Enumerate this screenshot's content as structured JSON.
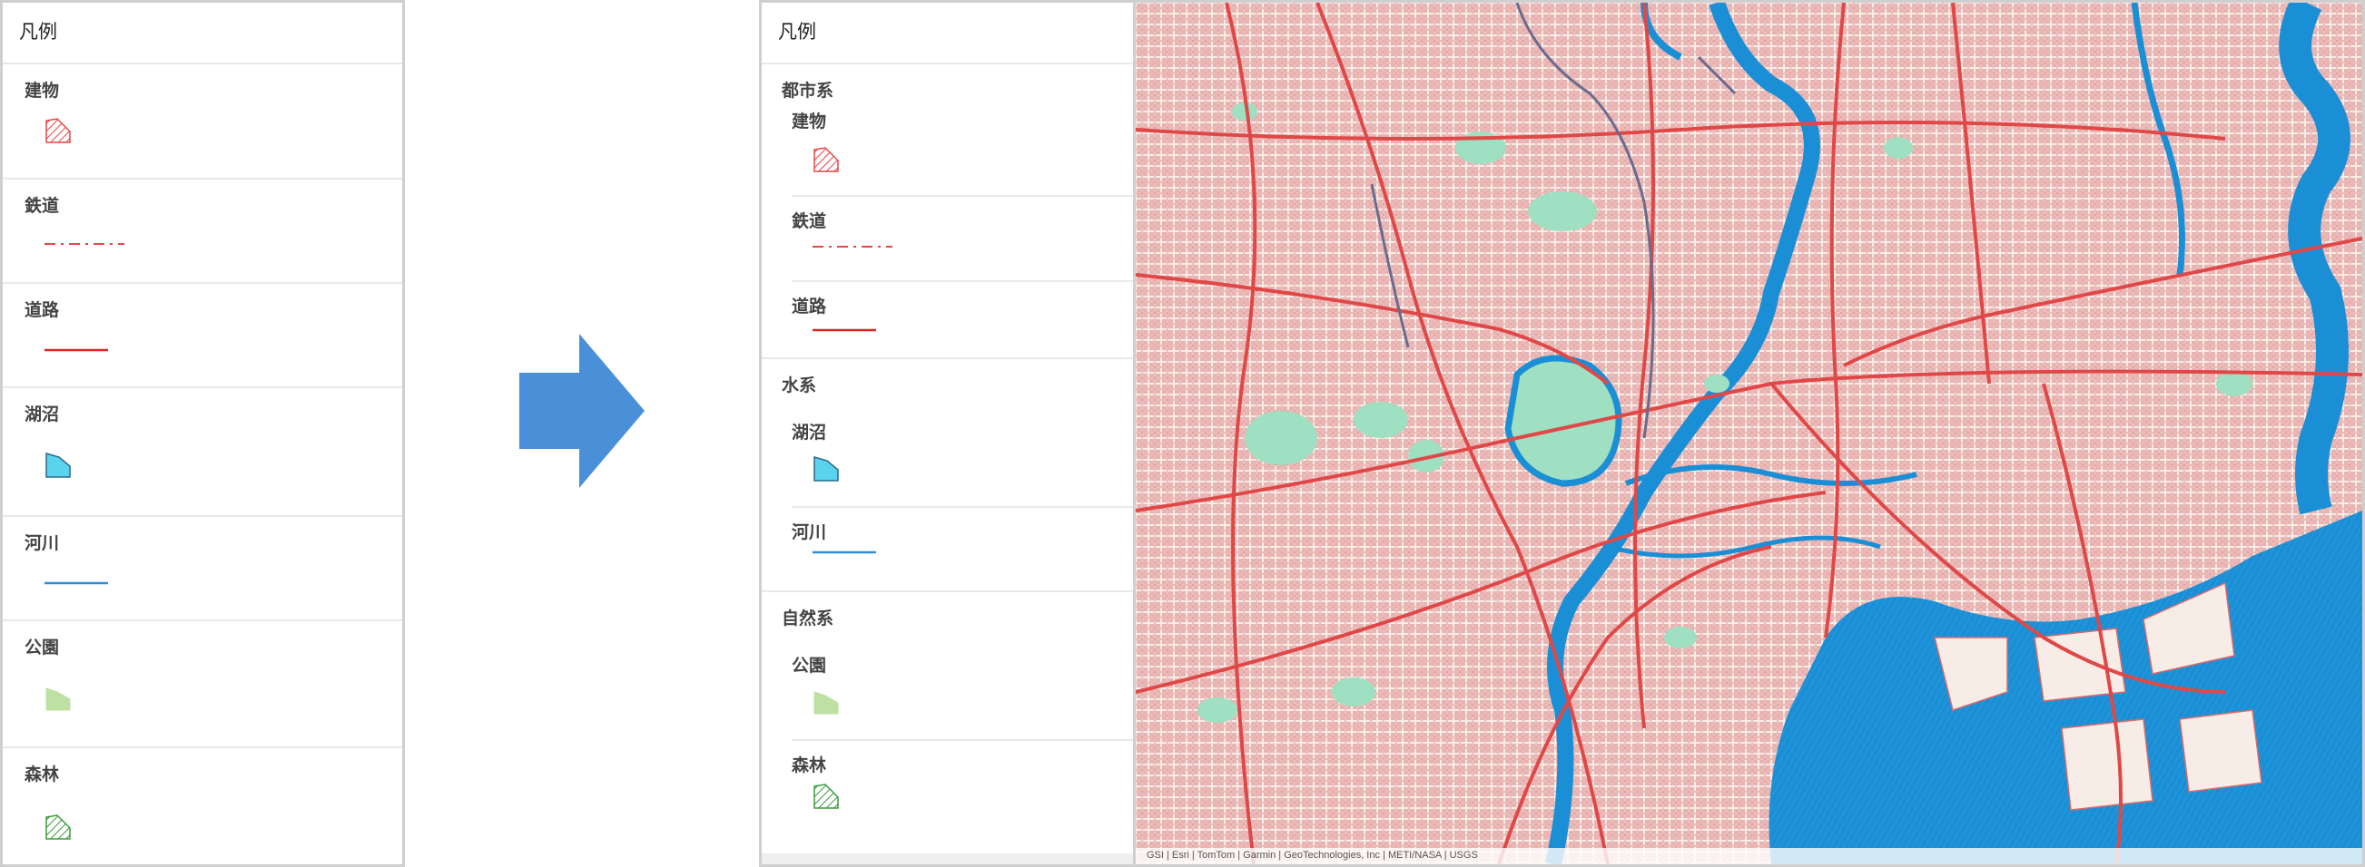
{
  "left_panel": {
    "title": "凡例",
    "items": [
      {
        "label": "建物",
        "symbol": "hatched-red-polygon"
      },
      {
        "label": "鉄道",
        "symbol": "red-dash-dot-line"
      },
      {
        "label": "道路",
        "symbol": "red-line"
      },
      {
        "label": "湖沼",
        "symbol": "cyan-polygon"
      },
      {
        "label": "河川",
        "symbol": "blue-line"
      },
      {
        "label": "公園",
        "symbol": "green-polygon"
      },
      {
        "label": "森林",
        "symbol": "hatched-green-polygon"
      }
    ]
  },
  "arrow": {
    "icon": "right-arrow-icon",
    "color": "#4a90d9"
  },
  "right_panel": {
    "title": "凡例",
    "groups": [
      {
        "label": "都市系",
        "items": [
          {
            "label": "建物",
            "symbol": "hatched-red-polygon"
          },
          {
            "label": "鉄道",
            "symbol": "red-dash-dot-line"
          },
          {
            "label": "道路",
            "symbol": "red-line"
          }
        ]
      },
      {
        "label": "水系",
        "items": [
          {
            "label": "湖沼",
            "symbol": "cyan-polygon"
          },
          {
            "label": "河川",
            "symbol": "blue-line"
          }
        ]
      },
      {
        "label": "自然系",
        "items": [
          {
            "label": "公園",
            "symbol": "green-polygon"
          },
          {
            "label": "森林",
            "symbol": "hatched-green-polygon"
          }
        ]
      }
    ]
  },
  "map": {
    "attribution": "GSI | Esri | TomTom | Garmin | GeoTechnologies, Inc | METI/NASA | USGS",
    "colors": {
      "land": "#f7ece6",
      "building": "#e2a1a1",
      "road": "#e04848",
      "water": "#1a8fd6",
      "park": "#9fe0c2",
      "rail": "#6b6b8e"
    }
  },
  "symbol_colors": {
    "building": "#e84545",
    "railway": "#e84545",
    "road": "#e02424",
    "lake": "#5ad4ee",
    "river": "#2a8fdc",
    "park": "#bfe0a3",
    "forest": "#3a9b3a"
  }
}
